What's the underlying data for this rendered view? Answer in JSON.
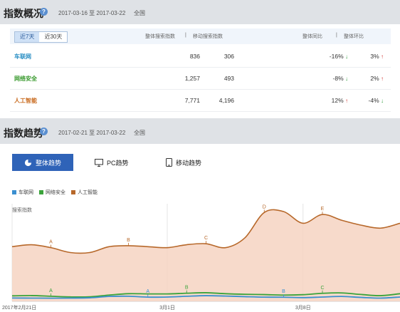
{
  "overview": {
    "title": "指数概况",
    "date_range": "2017-03-16 至 2017-03-22",
    "region": "全国",
    "tabs": [
      {
        "label": "近7天",
        "active": true
      },
      {
        "label": "近30天",
        "active": false
      }
    ],
    "col_headers": [
      "整体搜索指数",
      "移动搜索指数",
      "整体同比",
      "整体环比"
    ],
    "header_sep": "|",
    "rows": [
      {
        "keyword": "车联网",
        "color": "#2a8fc4",
        "overall": "836",
        "mobile": "306",
        "yoy": "-16%",
        "yoy_dir": "down",
        "mom": "3%",
        "mom_dir": "up"
      },
      {
        "keyword": "网络安全",
        "color": "#3a9a2f",
        "overall": "1,257",
        "mobile": "493",
        "yoy": "-8%",
        "yoy_dir": "down",
        "mom": "2%",
        "mom_dir": "up"
      },
      {
        "keyword": "人工智能",
        "color": "#c8691c",
        "overall": "7,771",
        "mobile": "4,196",
        "yoy": "12%",
        "yoy_dir": "up",
        "mom": "-4%",
        "mom_dir": "down"
      }
    ]
  },
  "trend": {
    "title": "指数趋势",
    "date_range": "2017-02-21 至 2017-03-22",
    "region": "全国",
    "modes": {
      "overall": "整体趋势",
      "pc": "PC趋势",
      "mobile": "移动趋势"
    }
  },
  "chart_data": {
    "type": "area",
    "ylabel": "搜索指数",
    "x_ticks": [
      "2017年2月21日",
      "3月1日",
      "3月8日"
    ],
    "x_tick_index": [
      0,
      8,
      15
    ],
    "series": [
      {
        "name": "车联网",
        "color": "#3a8fd0",
        "values": [
          340,
          330,
          320,
          330,
          360,
          500,
          520,
          430,
          440,
          520,
          580,
          540,
          480,
          430,
          420,
          380,
          440,
          500,
          400,
          330,
          440
        ]
      },
      {
        "name": "网络安全",
        "color": "#3aa33a",
        "values": [
          560,
          590,
          520,
          450,
          460,
          640,
          780,
          760,
          760,
          830,
          880,
          780,
          720,
          690,
          640,
          680,
          820,
          860,
          700,
          580,
          780
        ]
      },
      {
        "name": "人工智能",
        "color": "#b7682a",
        "values": [
          5600,
          5800,
          5500,
          5000,
          5000,
          5600,
          5700,
          5600,
          5500,
          5800,
          5900,
          5500,
          6500,
          9100,
          9200,
          8000,
          8900,
          8300,
          7800,
          7500,
          8000
        ]
      }
    ],
    "point_labels": [
      {
        "series": 2,
        "index": 2,
        "text": "A"
      },
      {
        "series": 2,
        "index": 6,
        "text": "B"
      },
      {
        "series": 2,
        "index": 10,
        "text": "C"
      },
      {
        "series": 2,
        "index": 13,
        "text": "D"
      },
      {
        "series": 2,
        "index": 16,
        "text": "E"
      },
      {
        "series": 1,
        "index": 2,
        "text": "A"
      },
      {
        "series": 0,
        "index": 7,
        "text": "A"
      },
      {
        "series": 1,
        "index": 9,
        "text": "B"
      },
      {
        "series": 0,
        "index": 14,
        "text": "B"
      },
      {
        "series": 1,
        "index": 16,
        "text": "C"
      }
    ]
  }
}
